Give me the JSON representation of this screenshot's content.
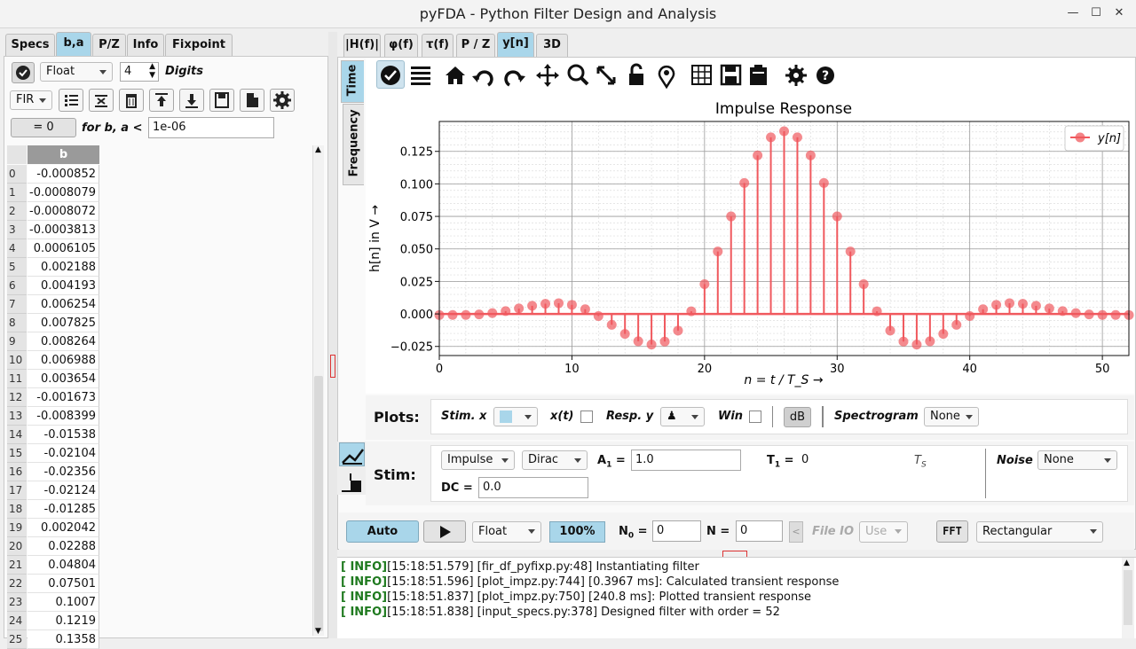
{
  "window": {
    "title": "pyFDA - Python Filter Design and Analysis"
  },
  "left": {
    "tabs": [
      "Specs",
      "b,a",
      "P/Z",
      "Info",
      "Fixpoint"
    ],
    "format": "Float",
    "digits_value": "4",
    "digits_label": "Digits",
    "filter_type": "FIR",
    "zero_button": "= 0",
    "zero_label": "for b, a <",
    "eps_value": "1e-06",
    "column_header": "b",
    "rows": [
      {
        "i": "0",
        "v": "-0.000852"
      },
      {
        "i": "1",
        "v": "-0.0008079"
      },
      {
        "i": "2",
        "v": "-0.0008072"
      },
      {
        "i": "3",
        "v": "-0.0003813"
      },
      {
        "i": "4",
        "v": "0.0006105"
      },
      {
        "i": "5",
        "v": "0.002188"
      },
      {
        "i": "6",
        "v": "0.004193"
      },
      {
        "i": "7",
        "v": "0.006254"
      },
      {
        "i": "8",
        "v": "0.007825"
      },
      {
        "i": "9",
        "v": "0.008264"
      },
      {
        "i": "10",
        "v": "0.006988"
      },
      {
        "i": "11",
        "v": "0.003654"
      },
      {
        "i": "12",
        "v": "-0.001673"
      },
      {
        "i": "13",
        "v": "-0.008399"
      },
      {
        "i": "14",
        "v": "-0.01538"
      },
      {
        "i": "15",
        "v": "-0.02104"
      },
      {
        "i": "16",
        "v": "-0.02356"
      },
      {
        "i": "17",
        "v": "-0.02124"
      },
      {
        "i": "18",
        "v": "-0.01285"
      },
      {
        "i": "19",
        "v": "0.002042"
      },
      {
        "i": "20",
        "v": "0.02288"
      },
      {
        "i": "21",
        "v": "0.04804"
      },
      {
        "i": "22",
        "v": "0.07501"
      },
      {
        "i": "23",
        "v": "0.1007"
      },
      {
        "i": "24",
        "v": "0.1219"
      },
      {
        "i": "25",
        "v": "0.1358"
      }
    ]
  },
  "right": {
    "tabs": [
      "|H(f)|",
      "φ(f)",
      "τ(f)",
      "P / Z",
      "y[n]",
      "3D"
    ],
    "side_tabs": [
      "Time",
      "Frequency"
    ],
    "toolbar_icons": [
      "check-icon",
      "list-icon",
      "home-icon",
      "undo-icon",
      "redo-icon",
      "pan-icon",
      "zoom-icon",
      "fullscreen-icon",
      "lock-icon",
      "marker-icon",
      "grid-icon",
      "save-icon",
      "clipboard-icon",
      "settings-icon",
      "help-icon"
    ]
  },
  "chart_data": {
    "type": "stem",
    "title": "Impulse Response",
    "xlabel": "n = t / T_S →",
    "ylabel": "h[n] in V →",
    "legend": "y[n]",
    "legend_position": "top-right",
    "xlim": [
      0,
      52
    ],
    "ylim": [
      -0.032,
      0.148
    ],
    "xticks": [
      0,
      10,
      20,
      30,
      40,
      50
    ],
    "yticks": [
      -0.025,
      0,
      0.025,
      0.05,
      0.075,
      0.1,
      0.125
    ],
    "ytick_labels": [
      "−0.025",
      "0.000",
      "0.025",
      "0.050",
      "0.075",
      "0.100",
      "0.125"
    ],
    "grid": true,
    "color": "#f0595e",
    "series": [
      {
        "name": "y[n]",
        "values": [
          -0.000852,
          -0.0008079,
          -0.0008072,
          -0.0003813,
          0.0006105,
          0.002188,
          0.004193,
          0.006254,
          0.007825,
          0.008264,
          0.006988,
          0.003654,
          -0.001673,
          -0.008399,
          -0.01538,
          -0.02104,
          -0.02356,
          -0.02124,
          -0.01285,
          0.002042,
          0.02288,
          0.04804,
          0.07501,
          0.1007,
          0.1219,
          0.1358,
          0.1405,
          0.1358,
          0.1219,
          0.1007,
          0.07501,
          0.04804,
          0.02288,
          0.002042,
          -0.01285,
          -0.02124,
          -0.02356,
          -0.02104,
          -0.01538,
          -0.008399,
          -0.001673,
          0.003654,
          0.006988,
          0.008264,
          0.007825,
          0.006254,
          0.004193,
          0.002188,
          0.0006105,
          -0.0003813,
          -0.0008072,
          -0.0008079,
          -0.000852
        ]
      }
    ]
  },
  "plots_panel": {
    "plots_label": "Plots:",
    "stim_x": "Stim. x",
    "xt": "x(t)",
    "resp_y": "Resp. y",
    "win": "Win",
    "db": "dB",
    "spectrogram": "Spectrogram",
    "spectrogram_value": "None"
  },
  "stim_panel": {
    "stim_label": "Stim:",
    "type1": "Impulse",
    "type2": "Dirac",
    "a1_label": "A",
    "a1_sub": "1",
    "a1_value": "1.0",
    "t1_label": "T",
    "t1_sub": "1",
    "t1_value": "0",
    "t1_unit": "T",
    "t1_unit_sub": "S",
    "noise_label": "Noise",
    "noise_value": "None",
    "dc_label": "DC =",
    "dc_value": "0.0"
  },
  "run_bar": {
    "auto": "Auto",
    "format": "Float",
    "percent": "100%",
    "n0_label": "N",
    "n0_sub": "0",
    "n0_value": "0",
    "n_label": "N =",
    "n_value": "0",
    "file_io": "File IO",
    "use": "Use",
    "fft": "FFT",
    "window": "Rectangular"
  },
  "log": [
    {
      "tag": "[ INFO]",
      "text": "[15:18:51.579] [fir_df_pyfixp.py:48] Instantiating filter"
    },
    {
      "tag": "[ INFO]",
      "text": "[15:18:51.596] [plot_impz.py:744] [0.3967 ms]: Calculated transient response"
    },
    {
      "tag": "[ INFO]",
      "text": "[15:18:51.837] [plot_impz.py:750] [240.8 ms]: Plotted transient response"
    },
    {
      "tag": "[ INFO]",
      "text": "[15:18:51.838] [input_specs.py:378] Designed filter with order = 52"
    }
  ]
}
